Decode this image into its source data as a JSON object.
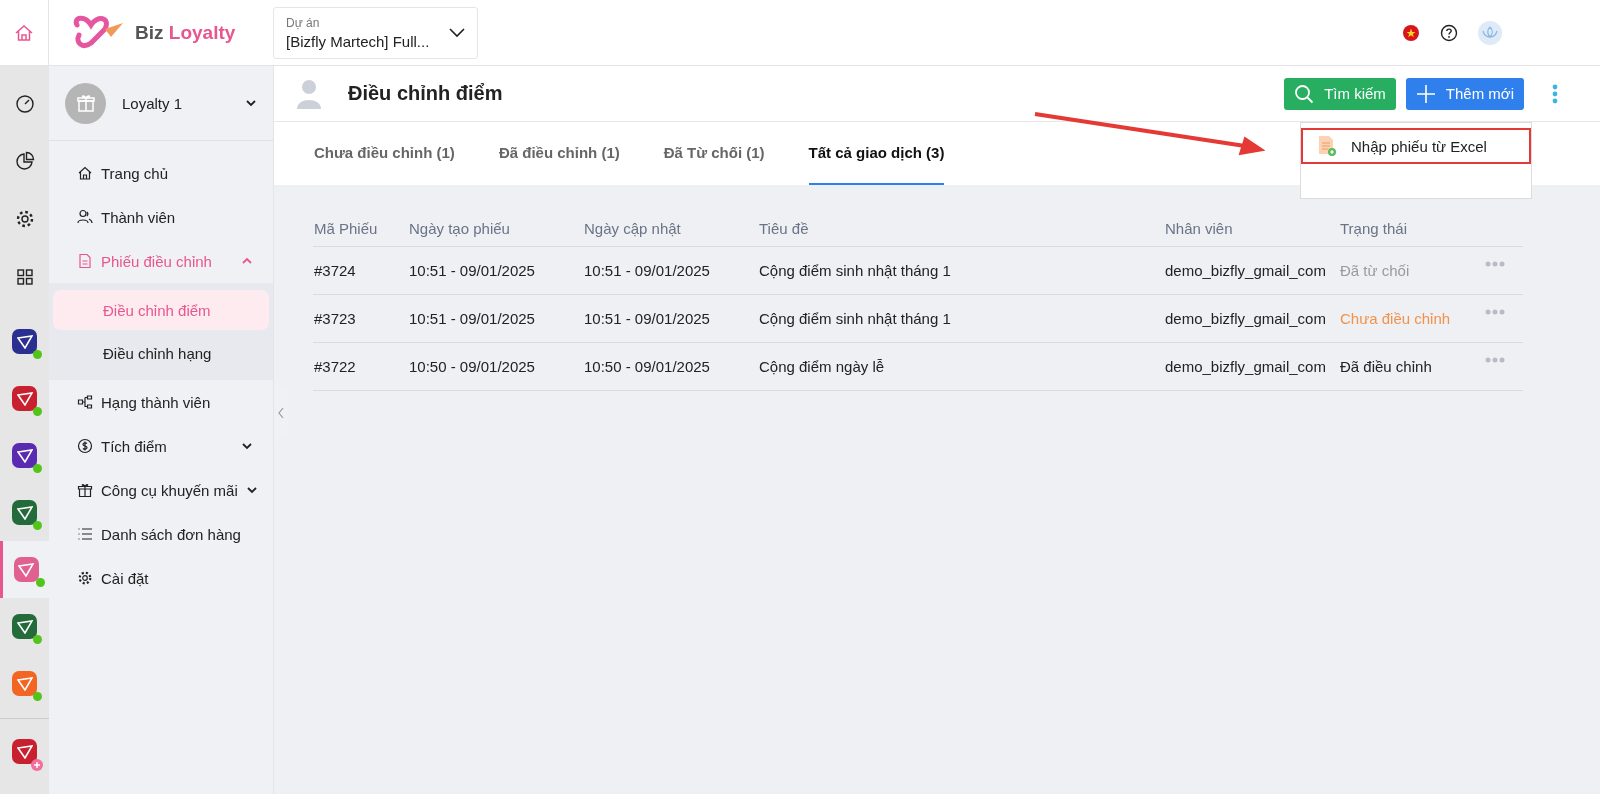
{
  "logo": {
    "first": "Biz",
    "second": "Loyalty"
  },
  "project": {
    "label": "Dự án",
    "value": "[Bizfly Martech] Full..."
  },
  "rail_apps": [
    {
      "color": "#2b2f8f",
      "selected": false,
      "kind": "online"
    },
    {
      "color": "#c8202f",
      "selected": false,
      "kind": "online"
    },
    {
      "color": "#5a2bb0",
      "selected": false,
      "kind": "online"
    },
    {
      "color": "#236b3a",
      "selected": false,
      "kind": "online"
    },
    {
      "color": "#e0608f",
      "selected": true,
      "kind": "online"
    },
    {
      "color": "#236b3a",
      "selected": false,
      "kind": "online"
    },
    {
      "color": "#f26522",
      "selected": false,
      "kind": "online"
    },
    {
      "color": "#c8202f",
      "selected": false,
      "kind": "add"
    }
  ],
  "account": {
    "name": "Loyalty 1"
  },
  "sidebar": {
    "items": [
      {
        "label": "Trang chủ",
        "selected": false,
        "kind": "link"
      },
      {
        "label": "Thành viên",
        "selected": false,
        "kind": "link"
      },
      {
        "label": "Phiếu điều chỉnh",
        "selected": true,
        "kind": "group",
        "expanded": true,
        "children": [
          {
            "label": "Điều chỉnh điểm",
            "selected": true
          },
          {
            "label": "Điều chỉnh hạng",
            "selected": false
          }
        ]
      },
      {
        "label": "Hạng thành viên",
        "selected": false,
        "kind": "link"
      },
      {
        "label": "Tích điểm",
        "selected": false,
        "kind": "group",
        "expanded": false
      },
      {
        "label": "Công cụ khuyến mãi",
        "selected": false,
        "kind": "group",
        "expanded": false
      },
      {
        "label": "Danh sách đơn hàng",
        "selected": false,
        "kind": "link"
      },
      {
        "label": "Cài đặt",
        "selected": false,
        "kind": "link"
      }
    ]
  },
  "page": {
    "title": "Điều chỉnh điểm",
    "search_button": "Tìm kiếm",
    "add_button": "Thêm mới"
  },
  "menu": {
    "items": [
      {
        "label": "Nhập phiếu từ Excel",
        "highlighted": true
      }
    ]
  },
  "tabs": [
    {
      "label": "Chưa điều chỉnh (1)",
      "selected": false
    },
    {
      "label": "Đã điều chỉnh (1)",
      "selected": false
    },
    {
      "label": "Đã Từ chối (1)",
      "selected": false
    },
    {
      "label": "Tất cả giao dịch (3)",
      "selected": true
    }
  ],
  "table": {
    "columns": [
      "Mã Phiếu",
      "Ngày tạo phiếu",
      "Ngày cập nhật",
      "Tiêu đề",
      "Nhân viên",
      "Trạng thái"
    ],
    "rows": [
      {
        "id": "#3724",
        "created": "10:51 - 09/01/2025",
        "updated": "10:51 - 09/01/2025",
        "title": "Cộng điểm sinh nhật tháng 1",
        "staff": "demo_bizfly_gmail_com",
        "status": "Đã từ chối",
        "kind": "rejected"
      },
      {
        "id": "#3723",
        "created": "10:51 - 09/01/2025",
        "updated": "10:51 - 09/01/2025",
        "title": "Cộng điểm sinh nhật tháng 1",
        "staff": "demo_bizfly_gmail_com",
        "status": "Chưa điều chỉnh",
        "kind": "pending"
      },
      {
        "id": "#3722",
        "created": "10:50 - 09/01/2025",
        "updated": "10:50 - 09/01/2025",
        "title": "Cộng điểm ngày lễ",
        "staff": "demo_bizfly_gmail_com",
        "status": "Đã điều chỉnh",
        "kind": "done"
      }
    ]
  }
}
